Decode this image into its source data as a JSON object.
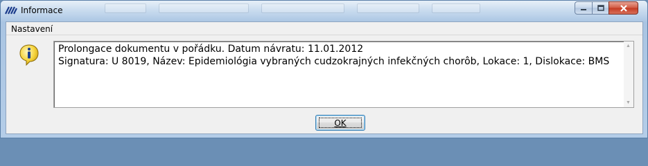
{
  "window": {
    "title": "Informace"
  },
  "menubar": {
    "items": [
      {
        "label": "Nastavení"
      }
    ]
  },
  "message": {
    "line1": "Prolongace dokumentu v pořádku. Datum návratu: 11.01.2012",
    "line2": "Signatura: U 8019, Název: Epidemiológia vybraných cudzokrajných infekčných chorôb, Lokace: 1, Dislokace: BMS"
  },
  "buttons": {
    "ok_label": "OK"
  },
  "icons": {
    "app": "app-logo-icon",
    "info": "info-icon",
    "minimize": "minimize-icon",
    "maximize": "maximize-icon",
    "close": "close-icon"
  },
  "colors": {
    "titlebar": "#b9d1ea",
    "close_button": "#c43a22",
    "info_icon": "#f5d33a",
    "ok_border": "#3c7fb1"
  }
}
